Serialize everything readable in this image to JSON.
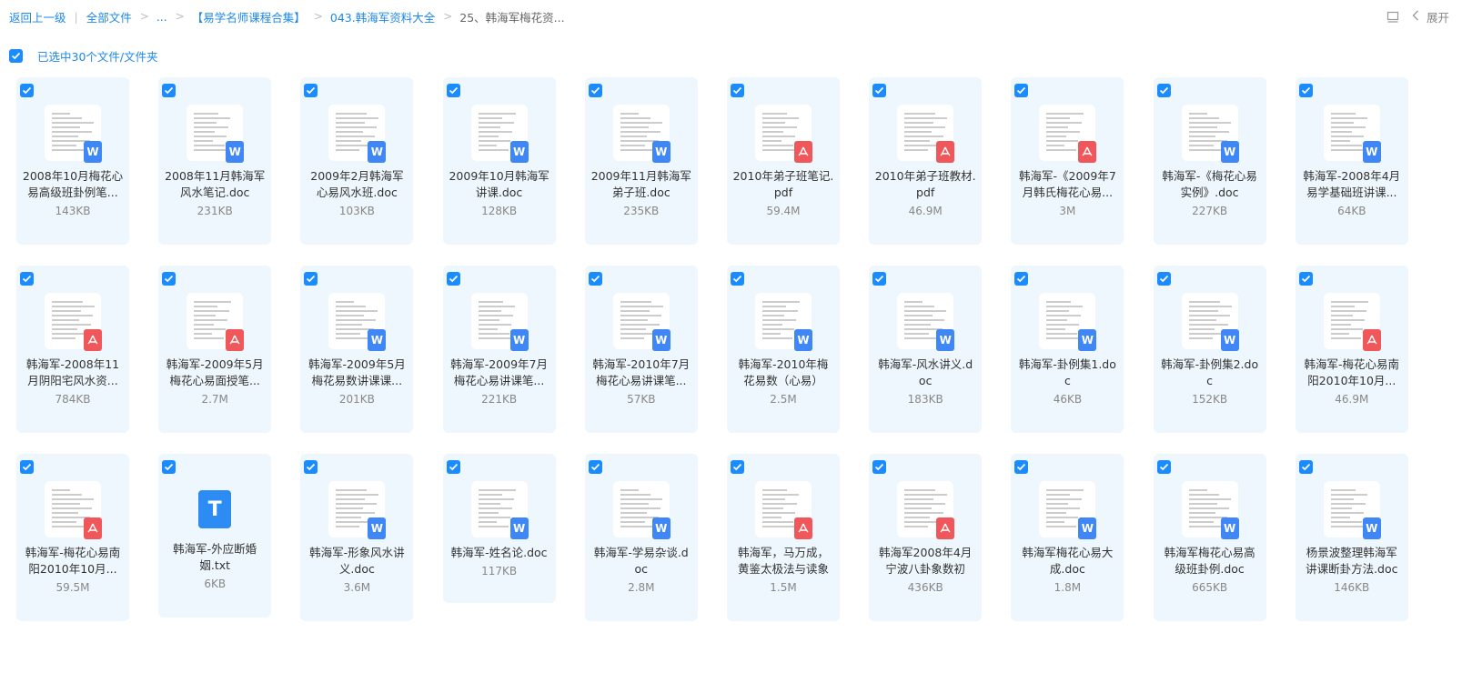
{
  "breadcrumb": {
    "back": "返回上一级",
    "all_files": "全部文件",
    "ellipsis": "...",
    "folder1": "【易学名师课程合集】",
    "folder2": "043.韩海军资料大全",
    "current": "25、韩海军梅花资..."
  },
  "toolbar": {
    "expand_label": "展开",
    "layout_icon": "layout-icon",
    "chevron_icon": "chevron-left-icon"
  },
  "selection": {
    "label": "已选中30个文件/文件夹",
    "checked": true
  },
  "colors": {
    "accent": "#1a8cff",
    "word": "#3f86f7",
    "pdf": "#f0575a",
    "card_bg": "#eef7fd"
  },
  "files": [
    {
      "name_line1": "2008年10月梅花心",
      "name_line2": "易高级班卦例笔...",
      "size": "143KB",
      "type": "word"
    },
    {
      "name_line1": "2008年11月韩海军",
      "name_line2": "风水笔记.doc",
      "size": "231KB",
      "type": "word"
    },
    {
      "name_line1": "2009年2月韩海军",
      "name_line2": "心易风水班.doc",
      "size": "103KB",
      "type": "word"
    },
    {
      "name_line1": "2009年10月韩海军",
      "name_line2": "讲课.doc",
      "size": "128KB",
      "type": "word"
    },
    {
      "name_line1": "2009年11月韩海军",
      "name_line2": "弟子班.doc",
      "size": "235KB",
      "type": "word"
    },
    {
      "name_line1": "2010年弟子班笔记.",
      "name_line2": "pdf",
      "size": "59.4M",
      "type": "pdf"
    },
    {
      "name_line1": "2010年弟子班教材.",
      "name_line2": "pdf",
      "size": "46.9M",
      "type": "pdf"
    },
    {
      "name_line1": "韩海军-《2009年7",
      "name_line2": "月韩氏梅花心易...",
      "size": "3M",
      "type": "pdf"
    },
    {
      "name_line1": "韩海军-《梅花心易",
      "name_line2": "实例》.doc",
      "size": "227KB",
      "type": "word"
    },
    {
      "name_line1": "韩海军-2008年4月",
      "name_line2": "易学基础班讲课...",
      "size": "64KB",
      "type": "word"
    },
    {
      "name_line1": "韩海军-2008年11",
      "name_line2": "月阴阳宅风水资...",
      "size": "784KB",
      "type": "pdf"
    },
    {
      "name_line1": "韩海军-2009年5月",
      "name_line2": "梅花心易面授笔...",
      "size": "2.7M",
      "type": "pdf"
    },
    {
      "name_line1": "韩海军-2009年5月",
      "name_line2": "梅花易数讲课课...",
      "size": "201KB",
      "type": "word"
    },
    {
      "name_line1": "韩海军-2009年7月",
      "name_line2": "梅花心易讲课笔...",
      "size": "221KB",
      "type": "word"
    },
    {
      "name_line1": "韩海军-2010年7月",
      "name_line2": "梅花心易讲课笔...",
      "size": "57KB",
      "type": "word"
    },
    {
      "name_line1": "韩海军-2010年梅",
      "name_line2": "花易数（心易）",
      "size": "2.5M",
      "type": "word"
    },
    {
      "name_line1": "韩海军-风水讲义.d",
      "name_line2": "oc",
      "size": "183KB",
      "type": "word"
    },
    {
      "name_line1": "韩海军-卦例集1.do",
      "name_line2": "c",
      "size": "46KB",
      "type": "word"
    },
    {
      "name_line1": "韩海军-卦例集2.do",
      "name_line2": "c",
      "size": "152KB",
      "type": "word"
    },
    {
      "name_line1": "韩海军-梅花心易南",
      "name_line2": "阳2010年10月...",
      "size": "46.9M",
      "type": "pdf"
    },
    {
      "name_line1": "韩海军-梅花心易南",
      "name_line2": "阳2010年10月...",
      "size": "59.5M",
      "type": "pdf"
    },
    {
      "name_line1": "韩海军-外应断婚",
      "name_line2": "姻.txt",
      "size": "6KB",
      "type": "txt"
    },
    {
      "name_line1": "韩海军-形象风水讲",
      "name_line2": "义.doc",
      "size": "3.6M",
      "type": "word"
    },
    {
      "name_line1": "韩海军-姓名论.doc",
      "name_line2": "",
      "size": "117KB",
      "type": "word"
    },
    {
      "name_line1": "韩海军-学易杂谈.d",
      "name_line2": "oc",
      "size": "2.8M",
      "type": "word"
    },
    {
      "name_line1": "韩海军，马万成，",
      "name_line2": "黄鉴太极法与读象",
      "size": "1.5M",
      "type": "pdf"
    },
    {
      "name_line1": "韩海军2008年4月",
      "name_line2": "宁波八卦象数初",
      "size": "436KB",
      "type": "pdf"
    },
    {
      "name_line1": "韩海军梅花心易大",
      "name_line2": "成.doc",
      "size": "1.8M",
      "type": "word"
    },
    {
      "name_line1": "韩海军梅花心易高",
      "name_line2": "级班卦例.doc",
      "size": "665KB",
      "type": "word"
    },
    {
      "name_line1": "杨景波整理韩海军",
      "name_line2": "讲课断卦方法.doc",
      "size": "146KB",
      "type": "word"
    }
  ]
}
